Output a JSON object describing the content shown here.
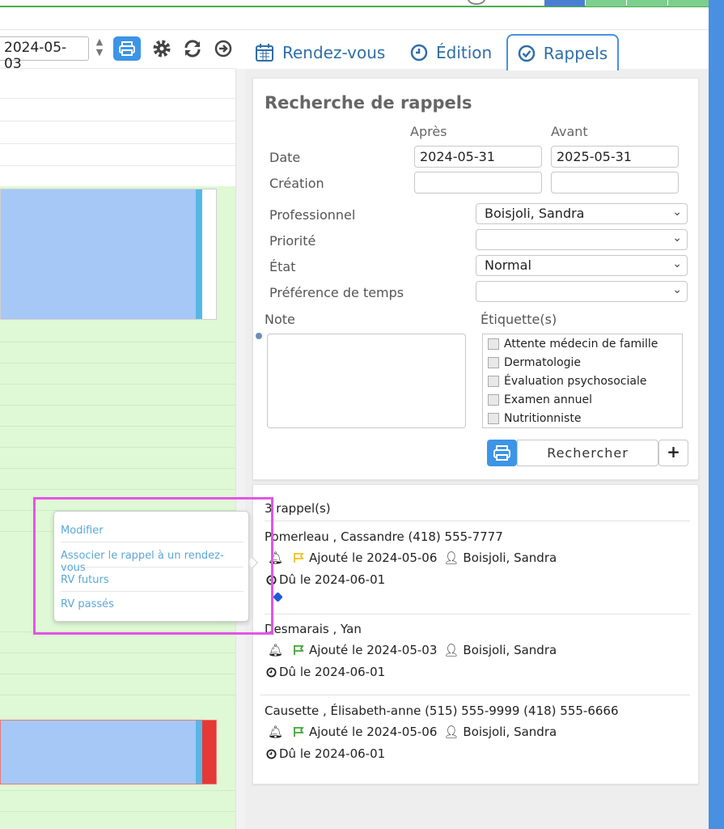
{
  "toolbar": {
    "date_value": "2024-05-03"
  },
  "tabs": [
    {
      "label": "Rendez-vous",
      "icon": "calendar-icon"
    },
    {
      "label": "Édition",
      "icon": "clock-icon"
    },
    {
      "label": "Rappels",
      "icon": "check-circle-icon"
    }
  ],
  "search": {
    "title": "Recherche de rappels",
    "col_after": "Après",
    "col_before": "Avant",
    "date_label": "Date",
    "date_after": "2024-05-31",
    "date_before": "2025-05-31",
    "creation_label": "Création",
    "creation_after": "",
    "creation_before": "",
    "professional_label": "Professionnel",
    "professional_value": "Boisjoli, Sandra",
    "priority_label": "Priorité",
    "priority_value": "",
    "state_label": "État",
    "state_value": "Normal",
    "time_pref_label": "Préférence de temps",
    "time_pref_value": "",
    "note_label": "Note",
    "tags_label": "Étiquette(s)",
    "tags": [
      "Attente médecin de famille",
      "Dermatologie",
      "Évaluation psychosociale",
      "Examen annuel",
      "Nutritionniste"
    ],
    "search_button": "Rechercher"
  },
  "results": {
    "count_label": "3 rappel(s)",
    "items": [
      {
        "name": "Pomerleau , Cassandre (418) 555-7777",
        "added": "Ajouté le 2024-05-06",
        "professional": "Boisjoli, Sandra",
        "due": "Dû le 2024-06-01",
        "flag_color": "#f3c21b"
      },
      {
        "name": "Desmarais , Yan",
        "added": "Ajouté le 2024-05-03",
        "professional": "Boisjoli, Sandra",
        "due": "Dû le 2024-06-01",
        "flag_color": "#3fa535"
      },
      {
        "name": "Causette , Élisabeth-anne (515) 555-9999 (418) 555-6666",
        "added": "Ajouté le 2024-05-06",
        "professional": "Boisjoli, Sandra",
        "due": "Dû le 2024-06-01",
        "flag_color": "#3fa535"
      }
    ]
  },
  "context_menu": {
    "items": [
      "Modifier",
      "Associer le rappel à un rendez-vous",
      "RV futurs",
      "RV passés"
    ]
  },
  "colors": {
    "accent": "#4a90e2",
    "tab_text": "#2f6ea8",
    "calendar_green": "#dff8d6",
    "appointment_blue": "#a6c8f7",
    "highlight": "#e455e6"
  }
}
